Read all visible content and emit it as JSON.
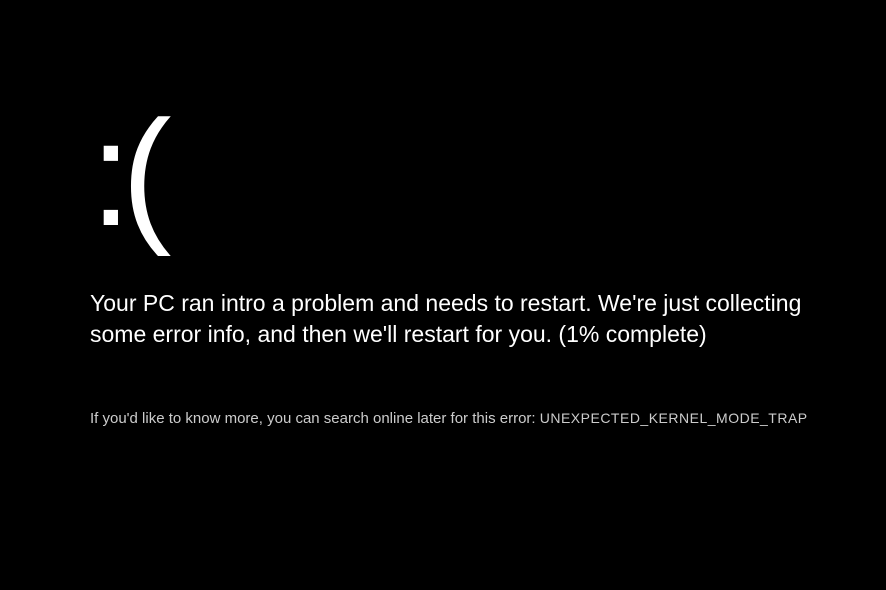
{
  "bsod": {
    "sad_face": ":(",
    "main_message": "Your PC ran intro a problem and needs to restart. We're just collecting some error info, and then we'll restart for you. (1% complete)",
    "secondary_prefix": "If you'd like to know more, you can search online later for this error: ",
    "error_code": "UNEXPECTED_KERNEL_MODE_TRAP"
  }
}
